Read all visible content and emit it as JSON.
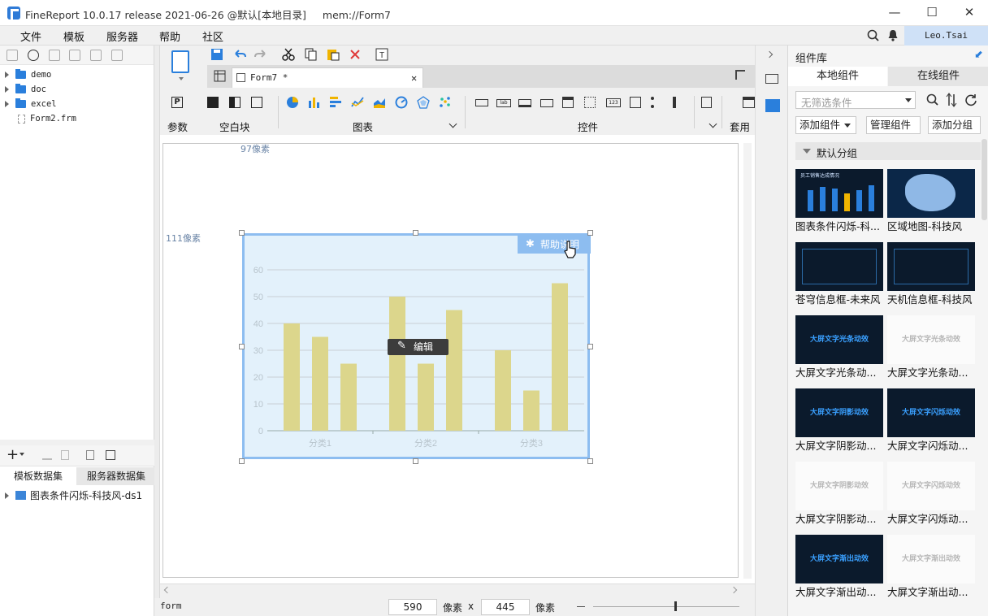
{
  "window": {
    "title": "FineReport 10.0.17 release 2021-06-26 @默认[本地目录]",
    "doc_path": "mem://Form7",
    "controls": {
      "minimize": "—",
      "maximize": "☐",
      "close": "✕"
    }
  },
  "menu": {
    "items": [
      "文件",
      "模板",
      "服务器",
      "帮助",
      "社区"
    ],
    "user": "Leo.Tsai"
  },
  "file_tree": {
    "items": [
      "demo",
      "doc",
      "excel",
      "Form2.frm"
    ]
  },
  "datasets": {
    "tabs": [
      "模板数据集",
      "服务器数据集"
    ],
    "items": [
      "图表条件闪烁-科技风-ds1"
    ]
  },
  "editor_tab": {
    "name": "Form7 *",
    "close": "✕"
  },
  "toolbar_groups": {
    "param": "参数",
    "blank": "空白块",
    "chart": "图表",
    "widget": "控件",
    "template": "套用组"
  },
  "canvas": {
    "top_ruler": "97像素",
    "left_ruler": "111像素",
    "help_button": "帮助说明",
    "edit_button": "编辑"
  },
  "chart_data": {
    "type": "bar",
    "categories": [
      "分类1",
      "分类2",
      "分类3"
    ],
    "series": [
      {
        "values": [
          40,
          50,
          30
        ]
      },
      {
        "values": [
          35,
          25,
          15
        ]
      },
      {
        "values": [
          25,
          45,
          55
        ]
      }
    ],
    "ylim": [
      0,
      60
    ],
    "yticks": [
      0,
      10,
      20,
      30,
      40,
      50,
      60
    ],
    "grid": true,
    "color": "#dcd68c"
  },
  "status": {
    "mode": "form",
    "width": "590",
    "width_unit": "像素",
    "separator": "x",
    "height": "445",
    "height_unit": "像素"
  },
  "component_library": {
    "title": "组件库",
    "tabs": [
      "本地组件",
      "在线组件"
    ],
    "filter_placeholder": "无筛选条件",
    "buttons": {
      "add_component": "添加组件",
      "manage_component": "管理组件",
      "add_group": "添加分组"
    },
    "group_name": "默认分组",
    "components": [
      {
        "label": "图表条件闪烁-科...",
        "thumb_text": "员工销售达成情况",
        "style": "dark"
      },
      {
        "label": "区域地图-科技风",
        "thumb_text": "",
        "style": "map"
      },
      {
        "label": "苍穹信息框-未来风",
        "thumb_text": "",
        "style": "dark"
      },
      {
        "label": "天机信息框-科技风",
        "thumb_text": "",
        "style": "dark"
      },
      {
        "label": "大屏文字光条动...",
        "thumb_text": "大屏文字光条动效",
        "style": "darktext"
      },
      {
        "label": "大屏文字光条动...",
        "thumb_text": "大屏文字光条动效",
        "style": "lighttext"
      },
      {
        "label": "大屏文字阴影动...",
        "thumb_text": "大屏文字阴影动效",
        "style": "darktext"
      },
      {
        "label": "大屏文字闪烁动...",
        "thumb_text": "大屏文字闪烁动效",
        "style": "darktext"
      },
      {
        "label": "大屏文字阴影动...",
        "thumb_text": "大屏文字阴影动效",
        "style": "lighttext"
      },
      {
        "label": "大屏文字闪烁动...",
        "thumb_text": "大屏文字闪烁动效",
        "style": "lighttext"
      },
      {
        "label": "大屏文字渐出动...",
        "thumb_text": "大屏文字渐出动效",
        "style": "darktext"
      },
      {
        "label": "大屏文字渐出动...",
        "thumb_text": "大屏文字渐出动效",
        "style": "lighttext"
      }
    ]
  }
}
